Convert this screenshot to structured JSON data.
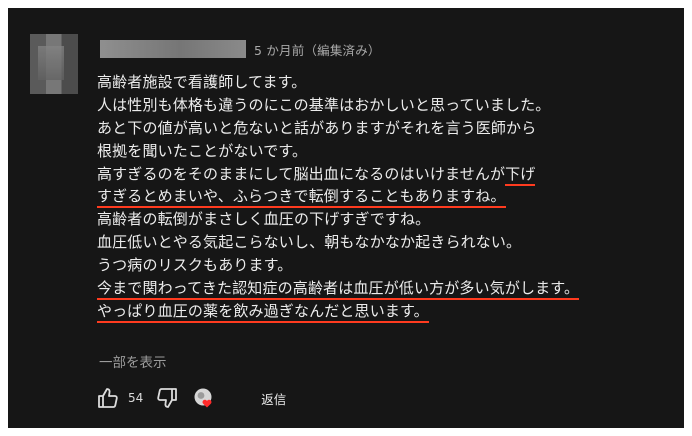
{
  "comment": {
    "timestamp": "5 か月前（編集済み）",
    "lines": [
      {
        "text": "高齢者施設で看護師してます。"
      },
      {
        "text": "人は性別も体格も違うのにこの基準はおかしいと思っていました。"
      },
      {
        "text": "あと下の値が高いと危ないと話がありますがそれを言う医師から"
      },
      {
        "text": "根拠を聞いたことがないです。"
      },
      {
        "pre": "高すぎるのをそのままにして脳出血になるのはいけませんが",
        "highlight": "下げ"
      },
      {
        "highlight": "すぎるとめまいや、ふらつきで転倒することもありますね。"
      },
      {
        "text": "高齢者の転倒がまさしく血圧の下げすぎですね。"
      },
      {
        "text": "血圧低いとやる気起こらないし、朝もなかなか起きられない。"
      },
      {
        "text": "うつ病のリスクもあります。"
      },
      {
        "highlight": "今まで関わってきた認知症の高齢者は血圧が低い方が多い気がします。"
      },
      {
        "highlight": "やっぱり血圧の薬を飲み過ぎなんだと思います。"
      }
    ],
    "show_more": "一部を表示",
    "like_count": "54",
    "reply_label": "返信"
  },
  "icons": {
    "like": "thumbs-up-icon",
    "dislike": "thumbs-down-icon",
    "creator_heart": "creator-heart-icon"
  },
  "colors": {
    "background": "#161616",
    "text": "#ececec",
    "highlight_underline": "#ff3b1f",
    "muted": "#9c9c9c"
  }
}
